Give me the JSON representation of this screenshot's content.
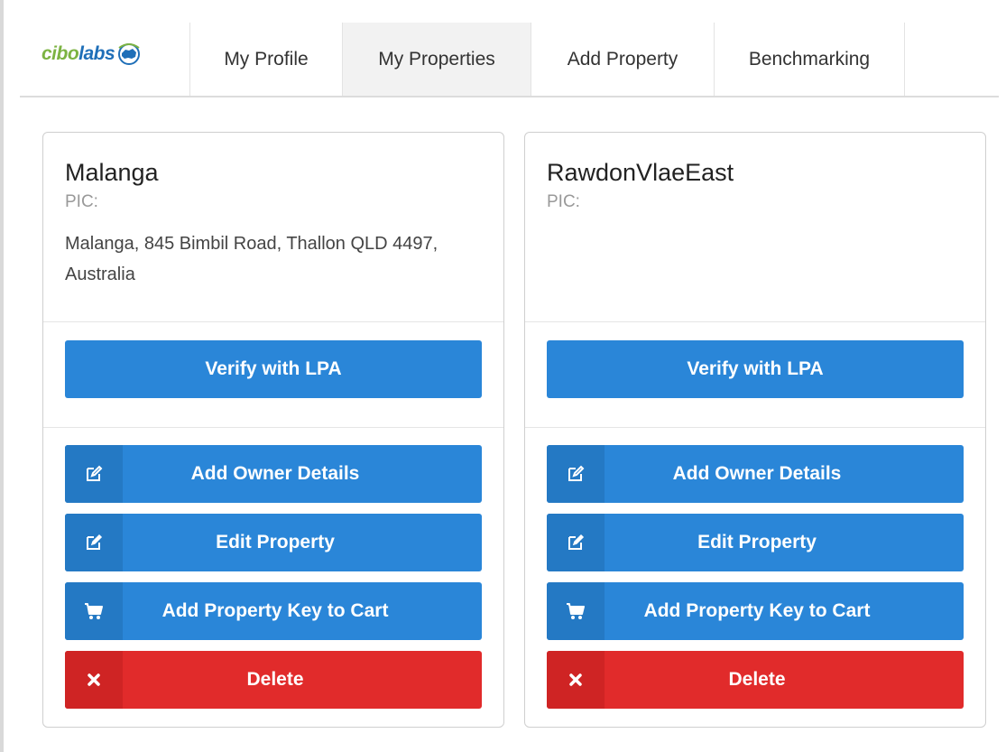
{
  "nav": {
    "logo_text_a": "cibo",
    "logo_text_b": "labs",
    "items": [
      {
        "label": "My Profile",
        "active": false
      },
      {
        "label": "My Properties",
        "active": true
      },
      {
        "label": "Add Property",
        "active": false
      },
      {
        "label": "Benchmarking",
        "active": false
      }
    ]
  },
  "colors": {
    "primary_blue": "#2a86d8",
    "danger_red": "#e12b2b",
    "logo_green": "#7cb342",
    "logo_blue": "#1f6fb8"
  },
  "properties": [
    {
      "name": "Malanga",
      "pic_label": "PIC:",
      "address": "Malanga, 845 Bimbil Road, Thallon QLD 4497, Australia",
      "verify_label": "Verify with LPA",
      "actions": [
        {
          "icon": "edit-icon",
          "label": "Add Owner Details"
        },
        {
          "icon": "edit-icon",
          "label": "Edit Property"
        },
        {
          "icon": "cart-icon",
          "label": "Add Property Key to Cart"
        },
        {
          "icon": "close-icon",
          "label": "Delete"
        }
      ]
    },
    {
      "name": "RawdonVlaeEast",
      "pic_label": "PIC:",
      "address": "",
      "verify_label": "Verify with LPA",
      "actions": [
        {
          "icon": "edit-icon",
          "label": "Add Owner Details"
        },
        {
          "icon": "edit-icon",
          "label": "Edit Property"
        },
        {
          "icon": "cart-icon",
          "label": "Add Property Key to Cart"
        },
        {
          "icon": "close-icon",
          "label": "Delete"
        }
      ]
    }
  ]
}
